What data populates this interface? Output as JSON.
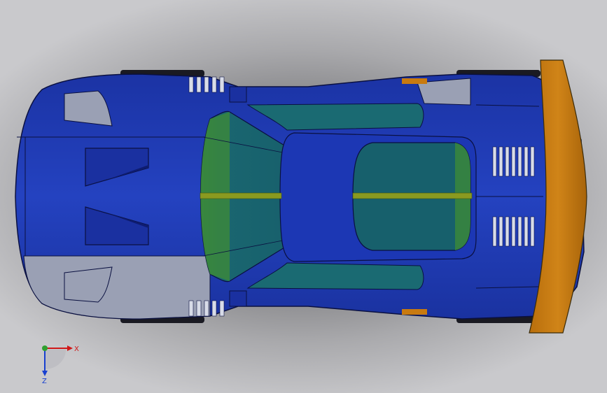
{
  "viewport": {
    "background_color": "#7a7a7d",
    "model": {
      "body_color": "#1f3ab0",
      "body_shade_color": "#14268a",
      "glass_color": "#1a6a72",
      "glass_edge_color": "#3c8a3a",
      "spine_color": "#8a9a20",
      "wing_color": "#c87a10",
      "grey_panel_color": "#9aa0b4"
    },
    "triad": {
      "x_label": "X",
      "z_label": "Z",
      "x_color": "#d01818",
      "z_color": "#1840d0",
      "origin_color": "#30a030"
    }
  }
}
